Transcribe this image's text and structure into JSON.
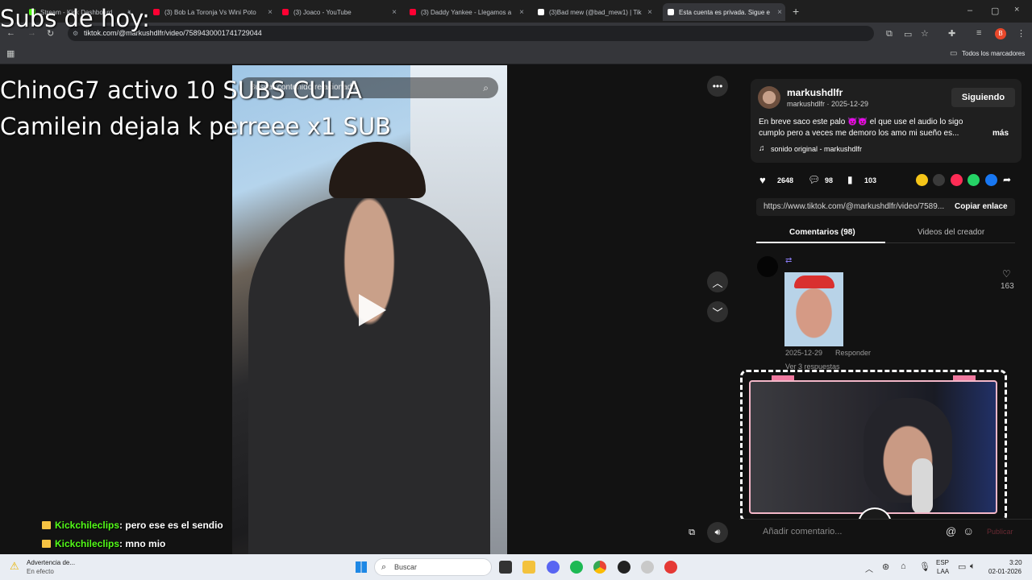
{
  "browser": {
    "tabs": [
      {
        "label": "Stream - Kick Dashboard",
        "favicon": "kick-icon",
        "color": "#53fc18"
      },
      {
        "label": "(3) Bob La Toronja Vs Wini Poto",
        "favicon": "youtube-icon",
        "color": "#ff0033"
      },
      {
        "label": "(3) Joaco - YouTube",
        "favicon": "youtube-icon",
        "color": "#ff0033"
      },
      {
        "label": "(3) Daddy Yankee - Llegamos a",
        "favicon": "youtube-icon",
        "color": "#ff0033"
      },
      {
        "label": "(3)Bad mew (@bad_mew1) | Tik",
        "favicon": "tiktok-icon",
        "color": "#ffffff"
      },
      {
        "label": "Esta cuenta es privada. Sigue e",
        "favicon": "tiktok-icon",
        "color": "#ffffff"
      }
    ],
    "url": "tiktok.com/@markushdlfr/video/7589430001741729044",
    "bookmarks_label": "Todos los marcadores",
    "profile_initial": "B"
  },
  "overlay": {
    "subs_title": "Subs de hoy:",
    "sub_line_1": "ChinoG7 activo 10 SUBS CULIA",
    "sub_line_2": "Camilein dejala k perreee x1 SUB"
  },
  "video": {
    "search_placeholder": "Buscar contenido relacionado"
  },
  "post": {
    "username": "markushdlfr",
    "handle_date": "markushdlfr · 2025-12-29",
    "follow_label": "Siguiendo",
    "caption_line_1": "En breve saco este palo 👿👿 el que use el audio lo sigo",
    "caption_line_2": "cumplo pero a veces me demoro los amo mi sueño es...",
    "more_label": "más",
    "sound": "sonido original - markushdlfr",
    "likes": "2648",
    "comments": "98",
    "saves": "103",
    "link": "https://www.tiktok.com/@markushdlfr/video/7589...",
    "copy_label": "Copiar enlace",
    "tab_comments": "Comentarios (98)",
    "tab_creator": "Videos del creador"
  },
  "comment": {
    "date": "2025-12-29",
    "reply_label": "Responder",
    "like_count": "163",
    "view_replies": "Ver 3 respuestas"
  },
  "composer": {
    "placeholder": "Añadir comentario...",
    "post_label": "Publicar"
  },
  "chat": [
    {
      "user": "Kickchileclips",
      "msg": ": pero ese es el sendio"
    },
    {
      "user": "Kickchileclips",
      "msg": ": mno mio"
    }
  ],
  "taskbar": {
    "notification_title": "Advertencia de...",
    "notification_sub": "En efecto",
    "search_label": "Buscar",
    "lang_1": "ESP",
    "lang_2": "LAA",
    "time": "3:20",
    "date": "02-01-2026"
  }
}
